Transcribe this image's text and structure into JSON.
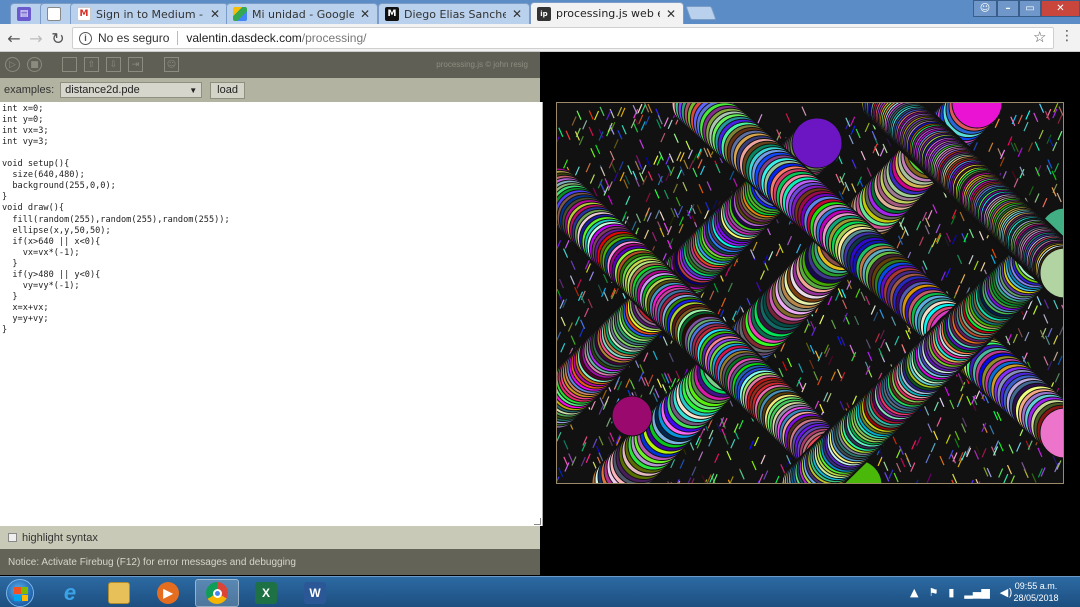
{
  "browser": {
    "tabs": [
      {
        "title": "",
        "icon": "calendar-icon"
      },
      {
        "title": "",
        "icon": "page-icon"
      },
      {
        "title": "Sign in to Medium - dieg",
        "icon": "gmail-icon"
      },
      {
        "title": "Mi unidad - Google Drive",
        "icon": "drive-icon"
      },
      {
        "title": "Diego Elias Sanchez Silva",
        "icon": "medium-icon"
      },
      {
        "title": "processing.js web editor",
        "icon": "processing-icon",
        "active": true
      }
    ],
    "security_label": "No es seguro",
    "url_host": "valentin.dasdeck.com",
    "url_path": "/processing/"
  },
  "editor": {
    "credit": "processing.js © john resig",
    "examples_label": "examples:",
    "selected_example": "distance2d.pde",
    "load_label": "load",
    "code_lines": [
      "int x=0;",
      "int y=0;",
      "int vx=3;",
      "int vy=3;",
      "",
      "void setup(){",
      "  size(640,480);",
      "  background(255,0,0);",
      "}",
      "void draw(){",
      "  fill(random(255),random(255),random(255));",
      "  ellipse(x,y,50,50);",
      "  if(x>640 || x<0){",
      "    vx=vx*(-1);",
      "  }",
      "  if(y>480 || y<0){",
      "    vy=vy*(-1);",
      "  }",
      "  x=x+vx;",
      "  y=y+vy;",
      "}"
    ],
    "highlight_label": "highlight syntax",
    "notice": "Notice: Activate Firebug (F12) for error messages and debugging"
  },
  "canvas": {
    "background": "#111111",
    "current_ball_color": "#9a0a6e"
  },
  "taskbar": {
    "apps": [
      "ie-icon",
      "explorer-icon",
      "media-player-icon",
      "chrome-icon",
      "excel-icon",
      "word-icon"
    ],
    "time": "09:55 a.m.",
    "date": "28/05/2018"
  }
}
